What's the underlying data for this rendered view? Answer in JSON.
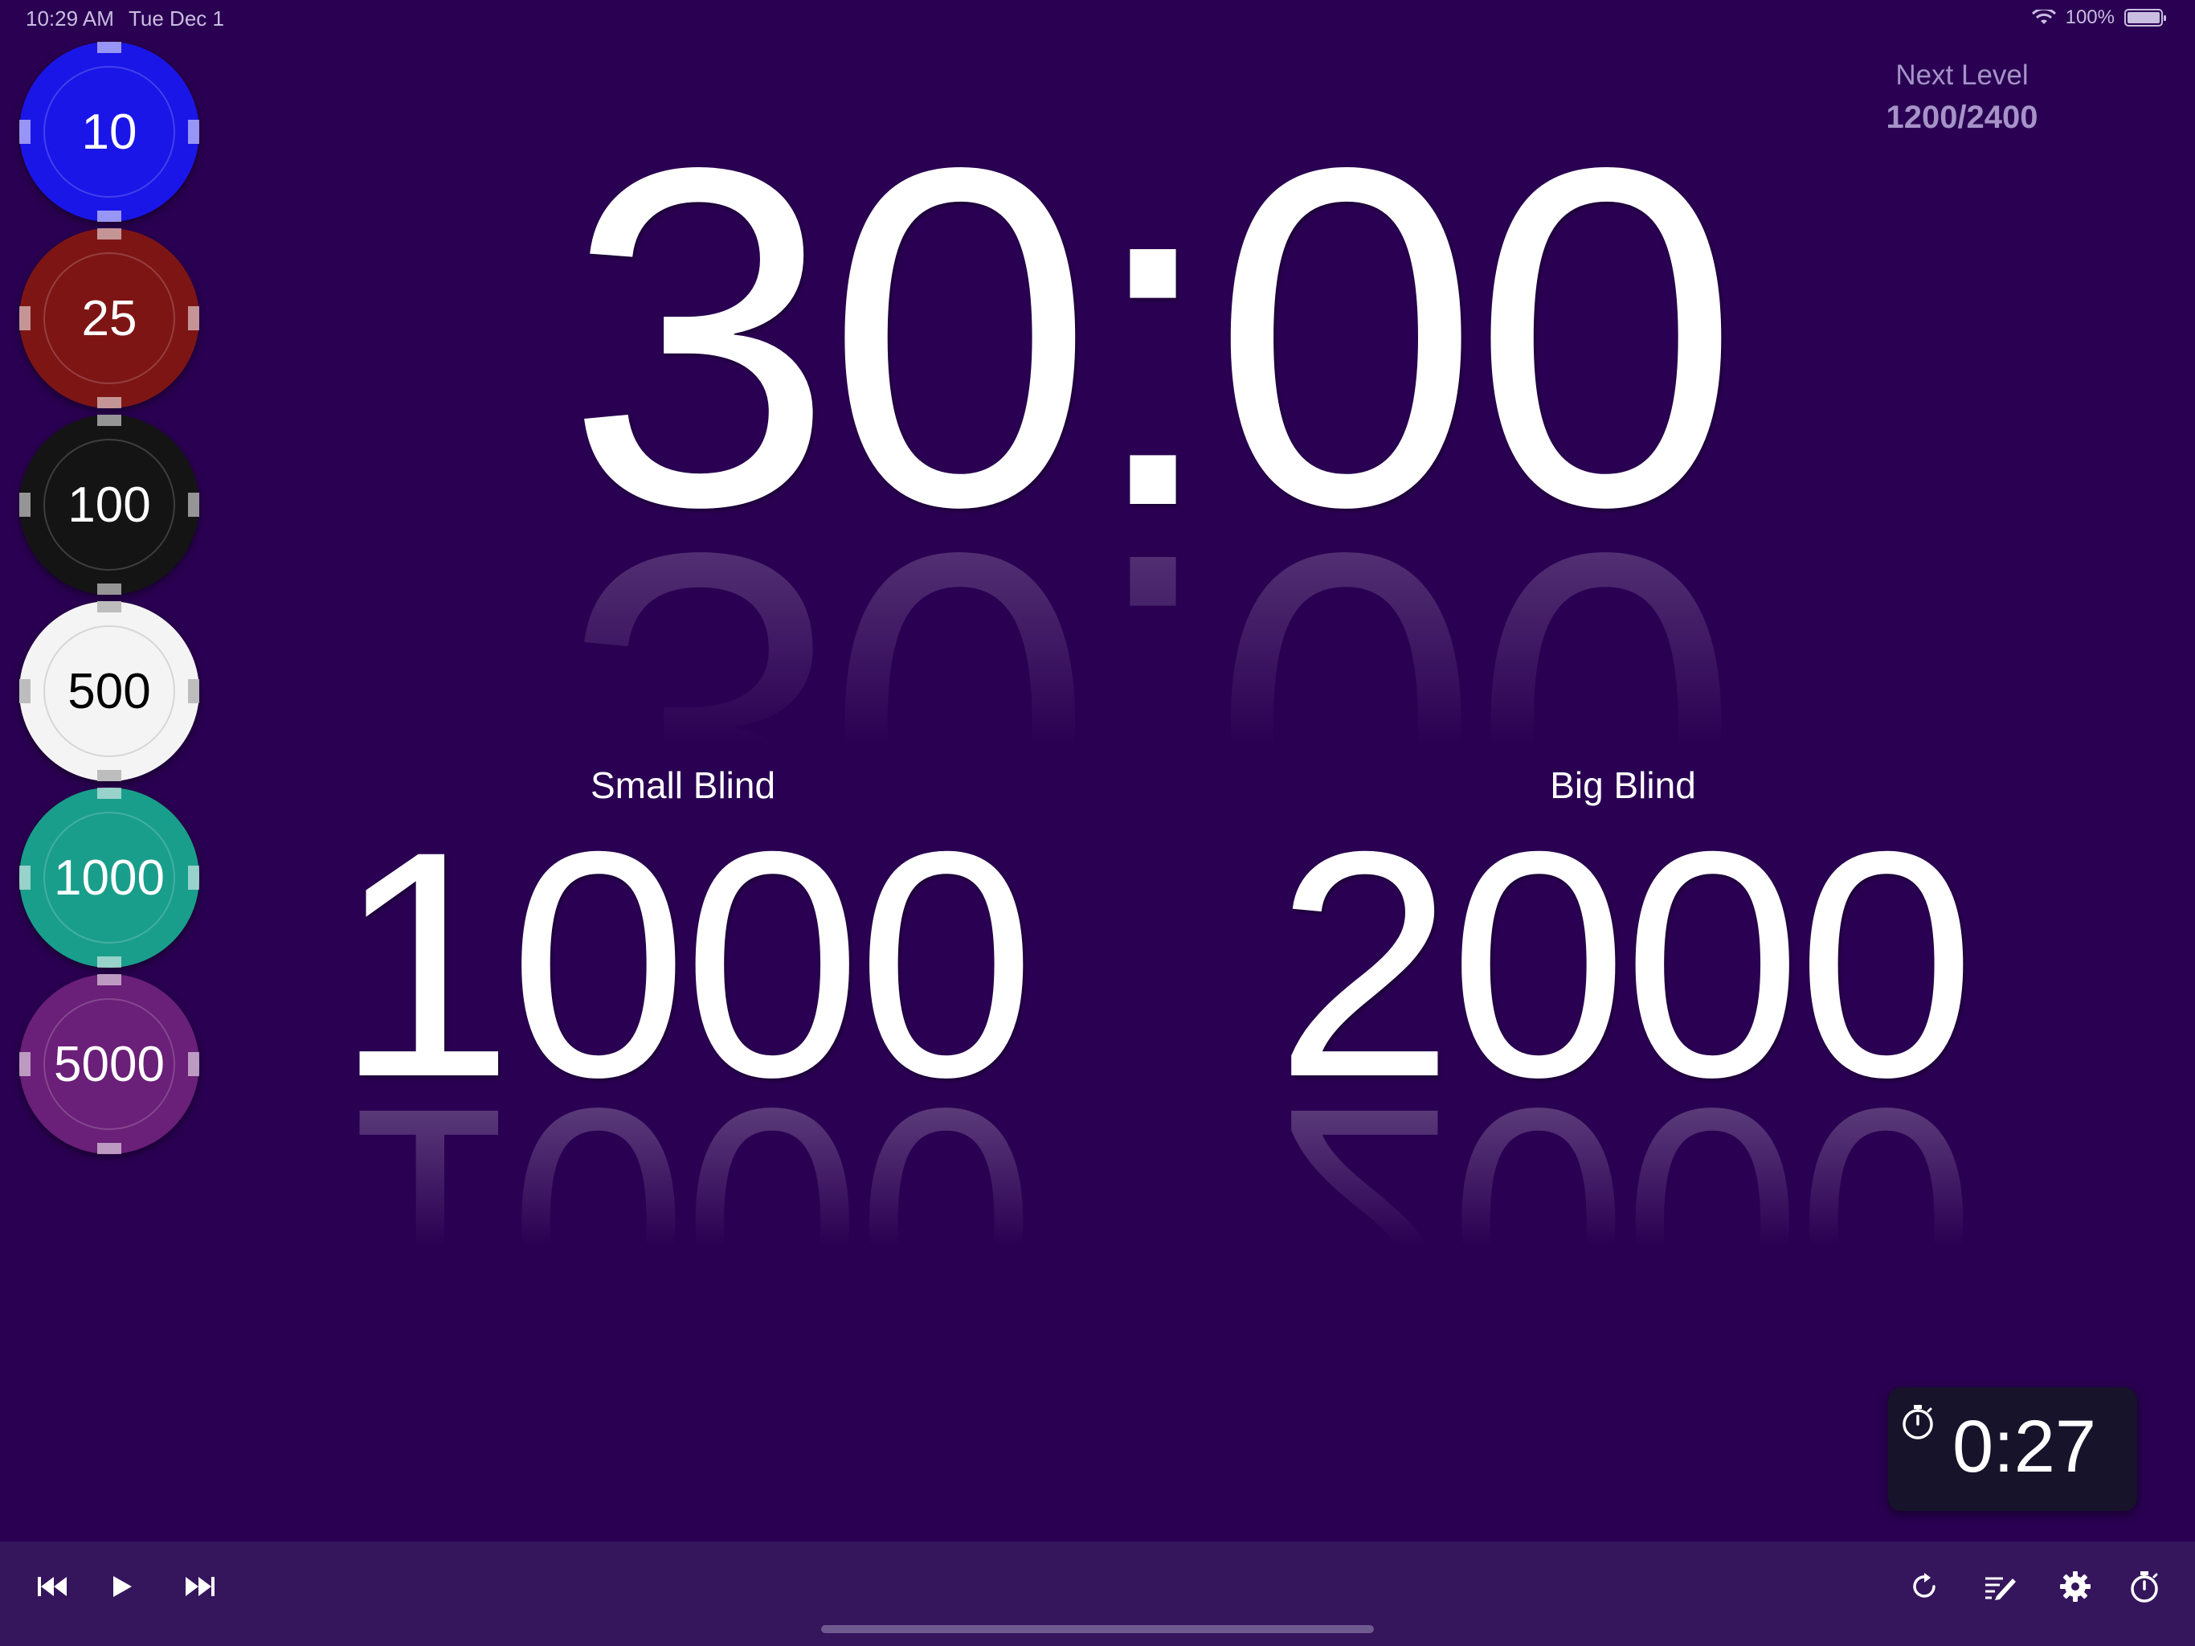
{
  "status_bar": {
    "time": "10:29 AM",
    "date": "Tue Dec 1",
    "battery": "100%"
  },
  "chips": [
    {
      "value": "10",
      "color": "#1a16e8",
      "text_color": "#ffffff"
    },
    {
      "value": "25",
      "color": "#7e1515",
      "text_color": "#ffffff"
    },
    {
      "value": "100",
      "color": "#141414",
      "text_color": "#ffffff"
    },
    {
      "value": "500",
      "color": "#f4f4f4",
      "text_color": "#000000"
    },
    {
      "value": "1000",
      "color": "#1a9e8c",
      "text_color": "#ffffff"
    },
    {
      "value": "5000",
      "color": "#6a1f78",
      "text_color": "#ffffff"
    }
  ],
  "timer": {
    "value": "30:00"
  },
  "next_level": {
    "label": "Next Level",
    "value": "1200/2400"
  },
  "small_blind": {
    "label": "Small Blind",
    "value": "1000"
  },
  "big_blind": {
    "label": "Big Blind",
    "value": "2000"
  },
  "mini_timer": {
    "value": "0:27",
    "icon": "stopwatch-icon"
  },
  "toolbar": {
    "left": [
      "skip-back-icon",
      "play-icon",
      "skip-forward-icon"
    ],
    "right": [
      "reset-icon",
      "edit-levels-icon",
      "gear-icon",
      "stopwatch-icon"
    ]
  },
  "colors": {
    "background": "#2a0052",
    "toolbar": "#35155c",
    "muted": "#a593c8"
  }
}
